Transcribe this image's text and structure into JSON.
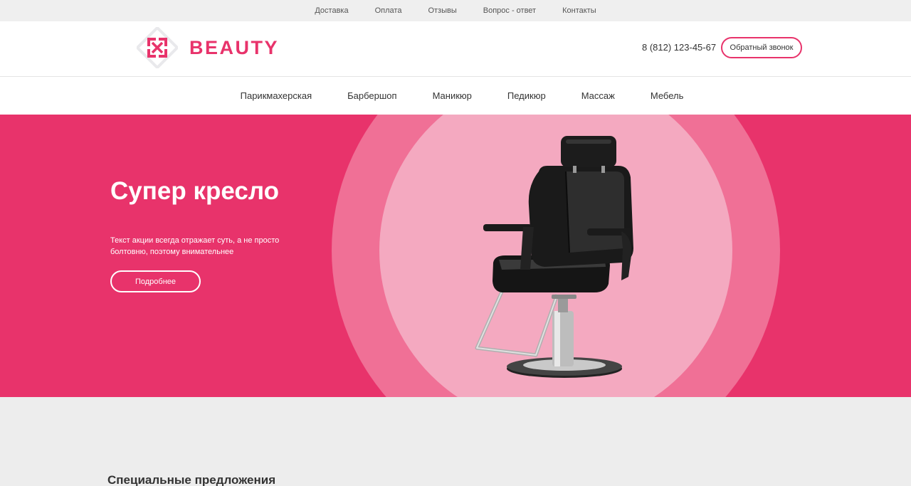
{
  "topbar": {
    "links": [
      "Доставка",
      "Оплата",
      "Отзывы",
      "Вопрос - ответ",
      "Контакты"
    ]
  },
  "header": {
    "logo_text": "BEAUTY",
    "phone": "8 (812) 123-45-67",
    "callback_label": "Обратный звонок"
  },
  "nav": {
    "items": [
      "Парикмахерская",
      "Барбершоп",
      "Маникюр",
      "Педикюр",
      "Массаж",
      "Мебель"
    ]
  },
  "hero": {
    "title": "Супер кресло",
    "text": "Текст акции всегда отражает суть, а не просто болтовню, поэтому внимательнее",
    "button_label": "Подробнее",
    "image_icon": "barber-chair-icon"
  },
  "section": {
    "title": "Специальные предложения"
  },
  "colors": {
    "accent": "#e8336b",
    "circle_outer": "#f07096",
    "circle_inner": "#f4a9c0",
    "page_bg": "#ededed"
  }
}
